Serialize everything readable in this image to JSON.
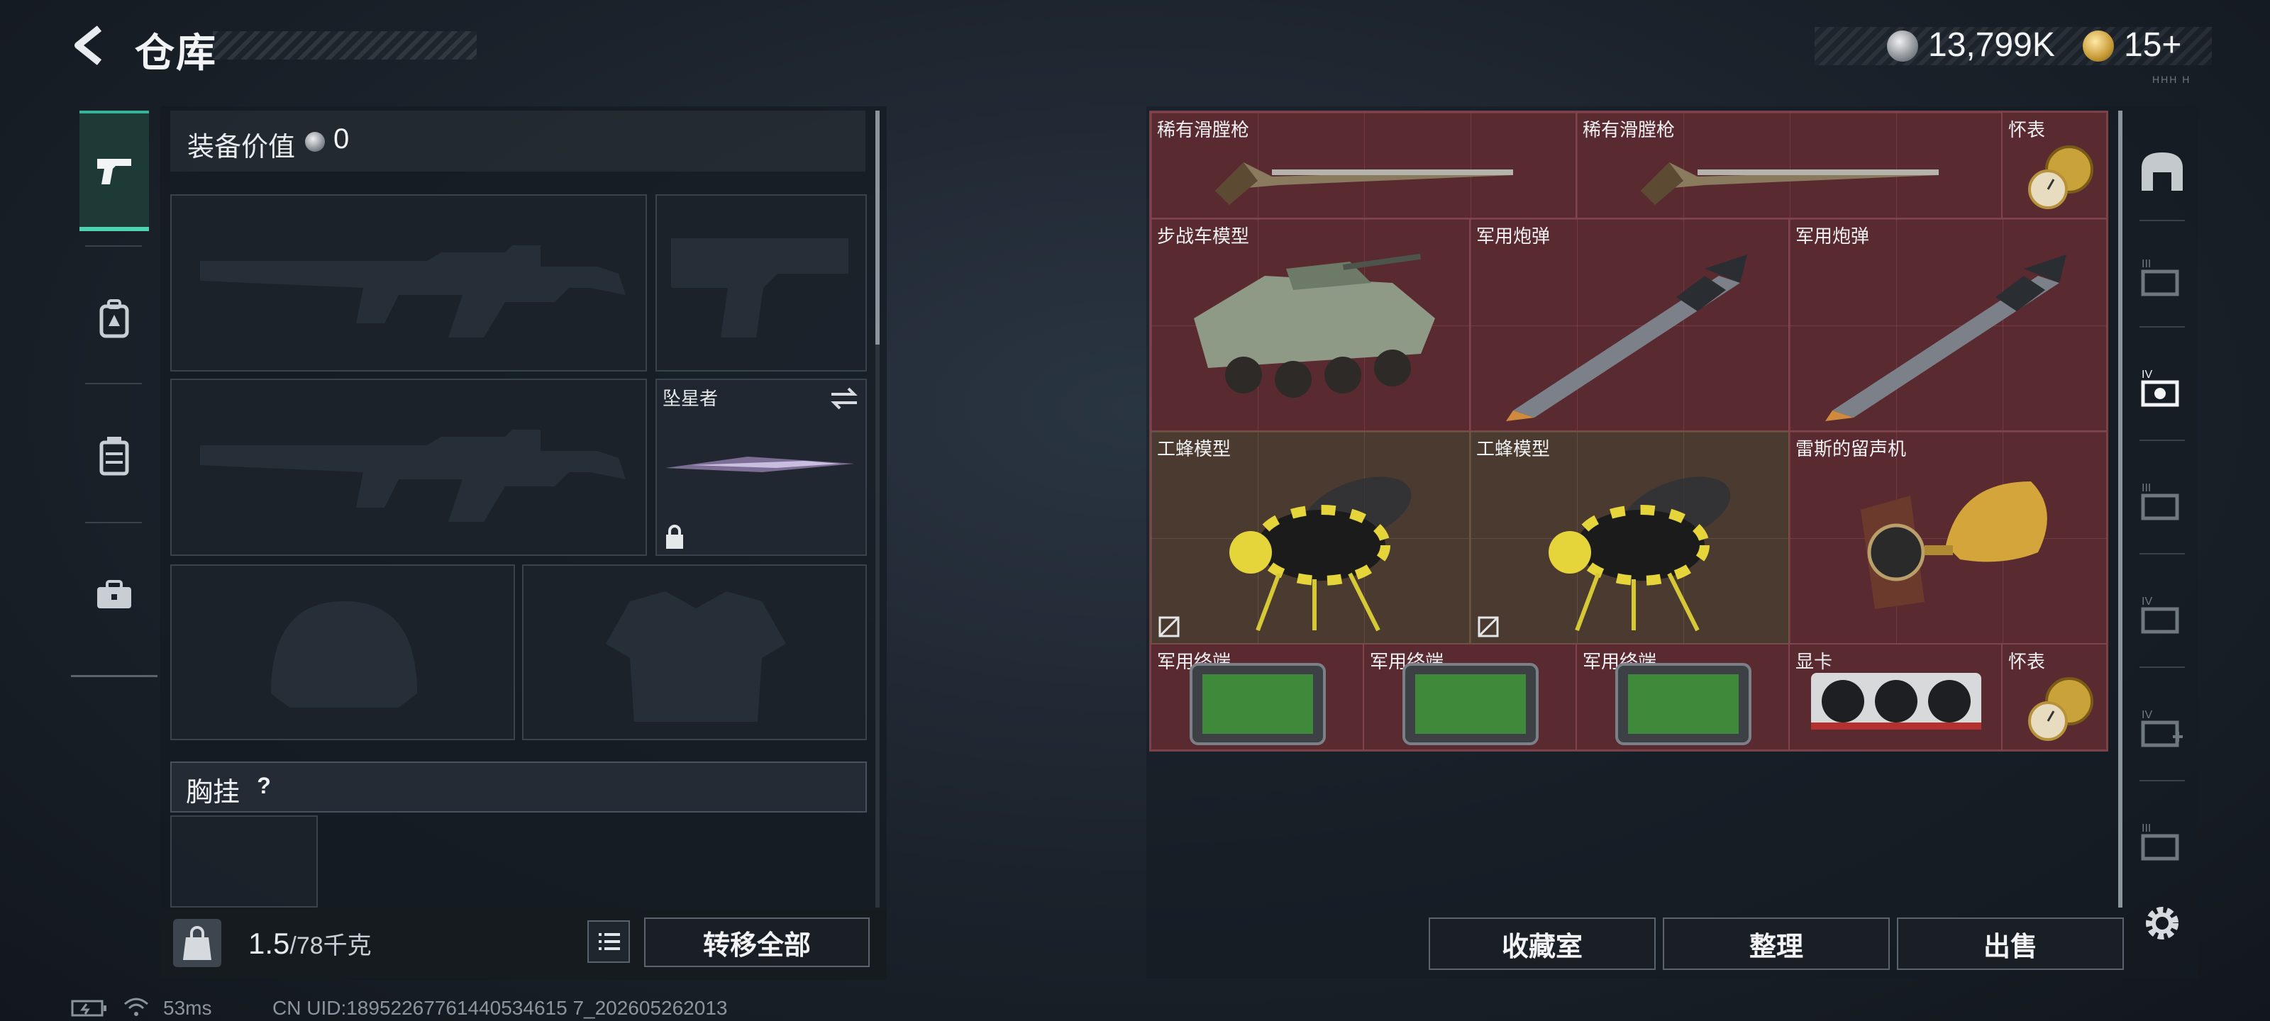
{
  "header": {
    "title": "仓库"
  },
  "currency": {
    "silver": "13,799K",
    "gold": "15+",
    "sub_text": "HHH H"
  },
  "equipment": {
    "value_label": "装备价值",
    "value": "0",
    "melee_slot_label": "坠星者",
    "chest_rig_label": "胸挂",
    "chest_rig_help": "?"
  },
  "inventory": {
    "weight_current": "1.5",
    "weight_max": "/78千克",
    "transfer_all_label": "转移全部"
  },
  "grid_items": [
    {
      "name": "稀有滑膛枪",
      "tag": "musket"
    },
    {
      "name": "稀有滑膛枪",
      "tag": "musket"
    },
    {
      "name": "怀表",
      "tag": "pocket-watch"
    },
    {
      "name": "步战车模型",
      "tag": "ifv-model"
    },
    {
      "name": "军用炮弹",
      "tag": "artillery-shell"
    },
    {
      "name": "军用炮弹",
      "tag": "artillery-shell"
    },
    {
      "name": "工蜂模型",
      "tag": "worker-bee-model"
    },
    {
      "name": "工蜂模型",
      "tag": "worker-bee-model"
    },
    {
      "name": "雷斯的留声机",
      "tag": "gramophone"
    },
    {
      "name": "军用终端",
      "tag": "military-terminal"
    },
    {
      "name": "军用终端",
      "tag": "military-terminal"
    },
    {
      "name": "军用终端",
      "tag": "military-terminal"
    },
    {
      "name": "显卡",
      "tag": "graphics-card"
    },
    {
      "name": "怀表",
      "tag": "pocket-watch"
    }
  ],
  "actions": {
    "collection_label": "收藏室",
    "sort_label": "整理",
    "sell_label": "出售"
  },
  "right_tabs": [
    {
      "icon": "home-icon"
    },
    {
      "label": "III"
    },
    {
      "label": "IV"
    },
    {
      "label": "III"
    },
    {
      "label": "IV"
    },
    {
      "label": "IV"
    },
    {
      "label": "III"
    }
  ],
  "status_bar": {
    "ping": "53ms",
    "uid": "CN UID:18952267761440534615 7_202605262013"
  },
  "colors": {
    "accent_teal": "#4fd3b1",
    "grid_red": "#5a2a31",
    "grid_brown": "#4a3a2f"
  }
}
